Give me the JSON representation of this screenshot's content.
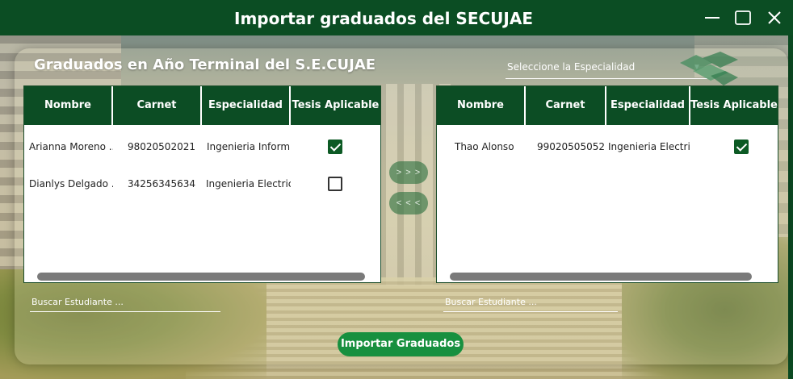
{
  "window": {
    "title": "Importar graduados del SECUJAE",
    "controls": [
      "minimize-icon",
      "maximize-icon",
      "close-icon"
    ]
  },
  "main": {
    "heading": "Graduados en Año Terminal del S.E.CUJAE",
    "specialty_placeholder": "Seleccione la Especialidad"
  },
  "left_table": {
    "columns": [
      "Nombre",
      "Carnet",
      "Especialidad",
      "Tesis Aplicable"
    ],
    "rows": [
      {
        "nombre": "Arianna Moreno ...",
        "carnet": "98020502021",
        "especialidad": "Ingenieria Inform...",
        "tesis": true
      },
      {
        "nombre": "Dianlys Delgado ...",
        "carnet": "34256345634",
        "especialidad": "Ingenieria Electrica",
        "tesis": false
      }
    ],
    "search_placeholder": "Buscar Estudiante ..."
  },
  "right_table": {
    "columns": [
      "Nombre",
      "Carnet",
      "Especialidad",
      "Tesis Aplicable"
    ],
    "rows": [
      {
        "nombre": "Thao Alonso",
        "carnet": "99020505052",
        "especialidad": "Ingenieria Electrica",
        "tesis": true
      }
    ],
    "search_placeholder": "Buscar Estudiante ..."
  },
  "buttons": {
    "move_right": "> > >",
    "move_left": "< < <",
    "import": "Importar Graduados"
  },
  "colors": {
    "titlebar": "#0b4d23",
    "header": "#0c4d24",
    "import_button": "#17903f"
  }
}
